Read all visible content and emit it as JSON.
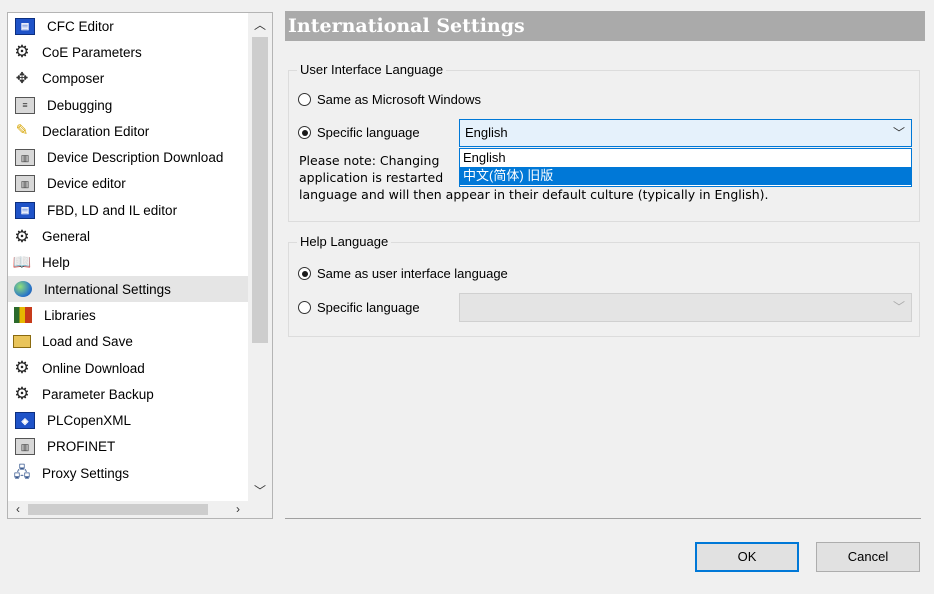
{
  "tree": {
    "items": [
      {
        "label": "CFC Editor",
        "icon": "cfc-editor-icon"
      },
      {
        "label": "CoE Parameters",
        "icon": "gear-icon"
      },
      {
        "label": "Composer",
        "icon": "composer-icon"
      },
      {
        "label": "Debugging",
        "icon": "debugging-icon"
      },
      {
        "label": "Declaration Editor",
        "icon": "pencil-icon"
      },
      {
        "label": "Device Description Download",
        "icon": "device-icon"
      },
      {
        "label": "Device editor",
        "icon": "device-icon"
      },
      {
        "label": "FBD, LD and IL editor",
        "icon": "fbd-editor-icon"
      },
      {
        "label": "General",
        "icon": "gear-icon"
      },
      {
        "label": "Help",
        "icon": "book-icon"
      },
      {
        "label": "International Settings",
        "icon": "globe-icon",
        "selected": true
      },
      {
        "label": "Libraries",
        "icon": "libraries-icon"
      },
      {
        "label": "Load and Save",
        "icon": "folder-icon"
      },
      {
        "label": "Online Download",
        "icon": "gear-icon"
      },
      {
        "label": "Parameter Backup",
        "icon": "gear-icon"
      },
      {
        "label": "PLCopenXML",
        "icon": "xml-icon"
      },
      {
        "label": "PROFINET",
        "icon": "profinet-icon"
      },
      {
        "label": "Proxy Settings",
        "icon": "proxy-icon"
      }
    ]
  },
  "header": {
    "title": "International Settings"
  },
  "ui_language": {
    "group_title": "User Interface Language",
    "same_as_windows_label": "Same as Microsoft Windows",
    "specific_label": "Specific language",
    "selected_value": "English",
    "note_line1": "Please note: Changing",
    "note_line2": "application is restarted",
    "note_line3": "language and will then appear in their default culture (typically in English).",
    "dropdown_options": [
      "English",
      "中文(简体) 旧版"
    ],
    "selected_option": "Specific language"
  },
  "help_language": {
    "group_title": "Help Language",
    "same_as_ui_label": "Same as user interface language",
    "specific_label": "Specific language",
    "selected_option": "Same as user interface language",
    "selected_value": ""
  },
  "buttons": {
    "ok": "OK",
    "cancel": "Cancel"
  },
  "colors": {
    "accent": "#0078d7",
    "header_bg": "#aaaaaa",
    "selection": "#e5e5e5"
  }
}
